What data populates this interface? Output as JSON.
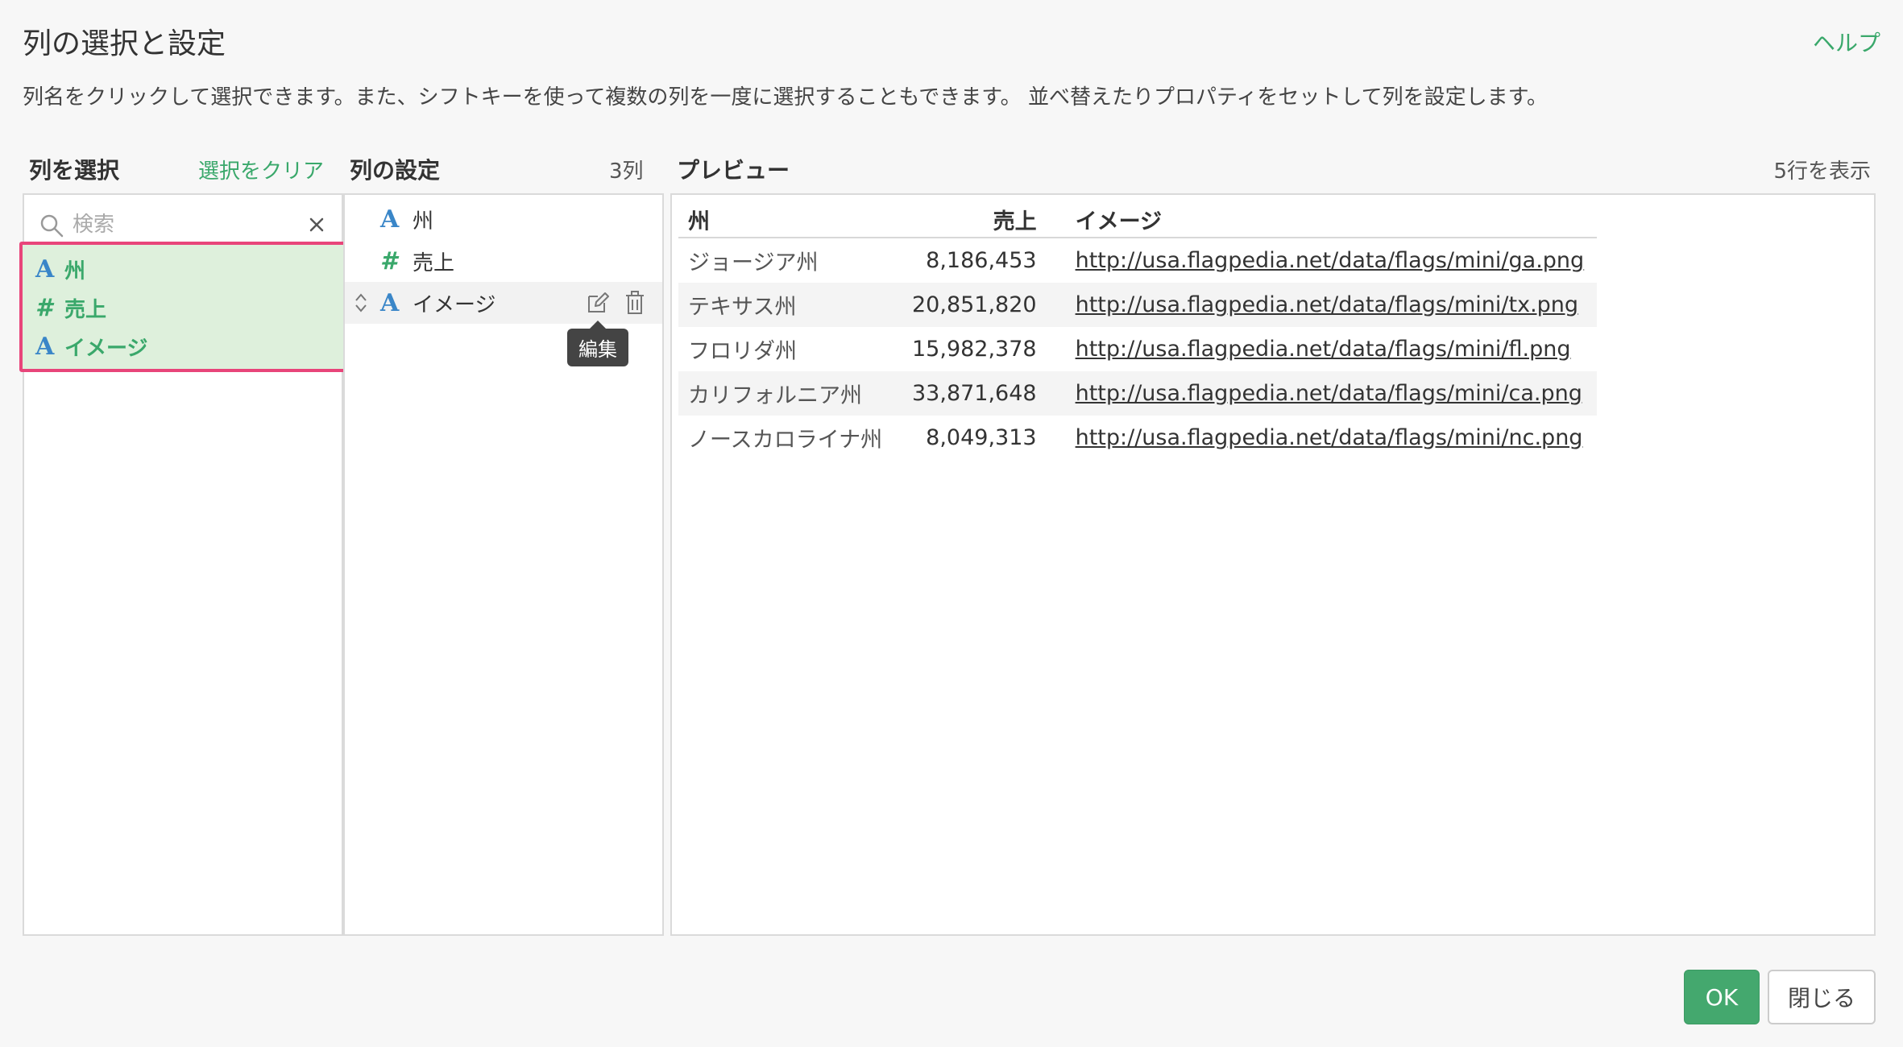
{
  "dialog": {
    "title": "列の選択と設定",
    "help_label": "ヘルプ",
    "description": "列名をクリックして選択できます。また、シフトキーを使って複数の列を一度に選択することもできます。 並べ替えたりプロパティをセットして列を設定します。"
  },
  "select_panel": {
    "heading": "列を選択",
    "clear_label": "選択をクリア",
    "search_placeholder": "検索",
    "items": [
      {
        "type": "A",
        "label": "州"
      },
      {
        "type": "#",
        "label": "売上"
      },
      {
        "type": "A",
        "label": "イメージ"
      }
    ]
  },
  "config_panel": {
    "heading": "列の設定",
    "count_label": "3列",
    "items": [
      {
        "type": "A",
        "label": "州"
      },
      {
        "type": "#",
        "label": "売上"
      },
      {
        "type": "A",
        "label": "イメージ"
      }
    ],
    "tooltip": "編集"
  },
  "preview_panel": {
    "heading": "プレビュー",
    "rows_label": "5行を表示",
    "columns": [
      "州",
      "売上",
      "イメージ"
    ],
    "rows": [
      [
        "ジョージア州",
        "8,186,453",
        "http://usa.flagpedia.net/data/flags/mini/ga.png"
      ],
      [
        "テキサス州",
        "20,851,820",
        "http://usa.flagpedia.net/data/flags/mini/tx.png"
      ],
      [
        "フロリダ州",
        "15,982,378",
        "http://usa.flagpedia.net/data/flags/mini/fl.png"
      ],
      [
        "カリフォルニア州",
        "33,871,648",
        "http://usa.flagpedia.net/data/flags/mini/ca.png"
      ],
      [
        "ノースカロライナ州",
        "8,049,313",
        "http://usa.flagpedia.net/data/flags/mini/nc.png"
      ]
    ]
  },
  "footer": {
    "ok_label": "OK",
    "close_label": "閉じる"
  },
  "colors": {
    "accent_green": "#3aa86b",
    "string_type_blue": "#3a86c8",
    "selection_highlight": "#e8457a",
    "selected_bg": "#def0dc"
  }
}
